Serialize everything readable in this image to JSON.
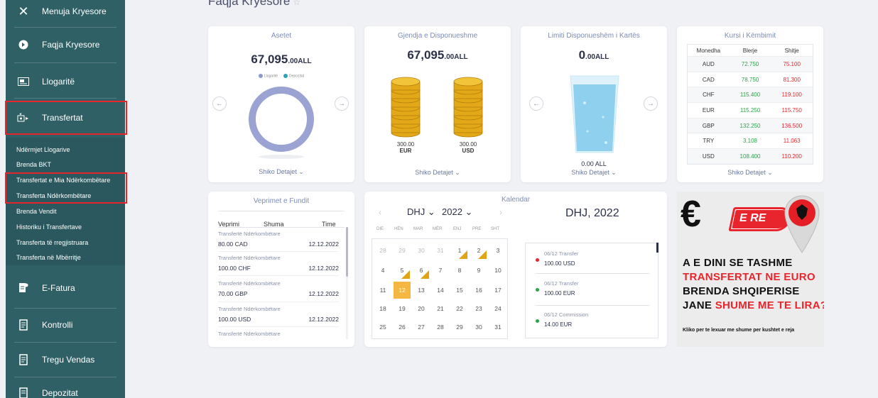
{
  "sidebar": {
    "menu_label": "Menuja Kryesore",
    "items": [
      {
        "label": "Faqja Kryesore",
        "icon": "home-icon"
      },
      {
        "label": "Llogaritë",
        "icon": "account-icon"
      },
      {
        "label": "Transfertat",
        "icon": "transfer-icon"
      },
      {
        "label": "E-Fatura",
        "icon": "invoice-icon"
      },
      {
        "label": "Kontrolli",
        "icon": "control-icon"
      },
      {
        "label": "Tregu Vendas",
        "icon": "market-icon"
      },
      {
        "label": "Depozitat",
        "icon": "deposit-icon"
      }
    ],
    "sub_items": [
      "Ndërmjet Llogarive",
      "Brenda BKT",
      "Transfertat e Mia Ndërkombëtare",
      "Transferta Ndërkombëtare",
      "Brenda Vendit",
      "Historiku i Transfertave",
      "Transferta të rregjistruara",
      "Transferta në Mbërritje"
    ]
  },
  "page": {
    "title": "Faqja Kryesore"
  },
  "assets": {
    "title": "Asetet",
    "amount_int": "67,095",
    "amount_dec": ".00",
    "currency": "ALL",
    "legend": [
      "Llogaritë",
      "Depozitat"
    ],
    "details": "Shiko Detajet"
  },
  "available": {
    "title": "Gjendja e Disponueshme",
    "amount_int": "67,095",
    "amount_dec": ".00",
    "currency": "ALL",
    "coins": [
      {
        "amount": "300.00",
        "currency": "EUR"
      },
      {
        "amount": "300.00",
        "currency": "USD"
      }
    ],
    "details": "Shiko Detajet"
  },
  "card_limit": {
    "title": "Limiti Disponueshëm i Kartës",
    "amount_int": "0",
    "amount_dec": ".00",
    "currency": "ALL",
    "bottom_value": "0.00 ALL",
    "details": "Shiko Detajet"
  },
  "exchange": {
    "title": "Kursi i Këmbimit",
    "headers": [
      "Monedha",
      "Blerje",
      "Shitje"
    ],
    "rows": [
      [
        "AUD",
        "72.750",
        "75.100"
      ],
      [
        "CAD",
        "78.750",
        "81.300"
      ],
      [
        "CHF",
        "115.400",
        "119.100"
      ],
      [
        "EUR",
        "115.250",
        "115.750"
      ],
      [
        "GBP",
        "132.250",
        "136.500"
      ],
      [
        "TRY",
        "3.108",
        "11.063"
      ],
      [
        "USD",
        "108.400",
        "110.200"
      ]
    ],
    "details": "Shiko Detajet"
  },
  "transactions": {
    "title": "Veprimet e Fundit",
    "headers": [
      "Veprimi",
      "Shuma",
      "Time"
    ],
    "items": [
      {
        "desc": "Transfertë Ndërkombëtare",
        "amount": "80.00 CAD",
        "date": "12.12.2022"
      },
      {
        "desc": "Transfertë Ndërkombëtare",
        "amount": "100.00 CHF",
        "date": "12.12.2022"
      },
      {
        "desc": "Transfertë Ndërkombëtare",
        "amount": "70.00 GBP",
        "date": "12.12.2022"
      },
      {
        "desc": "Transfertë Ndërkombëtare",
        "amount": "100.00 USD",
        "date": "12.12.2022"
      },
      {
        "desc": "Transfertë Ndërkombëtare",
        "amount": "",
        "date": ""
      }
    ]
  },
  "calendar": {
    "title": "Kalendar",
    "month": "DHJ",
    "year": "2022",
    "heading": "DHJ, 2022",
    "dow": [
      "DIE",
      "HËN",
      "MAR",
      "MËR",
      "ENJ",
      "PRE",
      "SHT"
    ],
    "weeks": [
      [
        "28",
        "29",
        "30",
        "31",
        "1",
        "2",
        "3"
      ],
      [
        "4",
        "5",
        "6",
        "7",
        "8",
        "9",
        "10"
      ],
      [
        "11",
        "12",
        "13",
        "14",
        "15",
        "16",
        "17"
      ],
      [
        "18",
        "19",
        "20",
        "21",
        "22",
        "23",
        "24"
      ],
      [
        "25",
        "26",
        "27",
        "28",
        "29",
        "30",
        "31"
      ]
    ],
    "events": [
      {
        "title": "06/12 Transfer",
        "value": "100.00 USD",
        "color": "#e8242c"
      },
      {
        "title": "06/12 Transfer",
        "value": "100.00 EUR",
        "color": "#2da24b"
      },
      {
        "title": "06/12 Commission",
        "value": "14.00 EUR",
        "color": "#2da24b"
      }
    ]
  },
  "ad": {
    "badge": "E RE",
    "line1": "A E DINI SE TASHME",
    "line2": "TRANSFERTAT NE EURO",
    "line3": "BRENDA SHQIPERISE",
    "line4a": "JANE ",
    "line4b": "SHUME ME TE LIRA?",
    "footer": "Kliko per te lexuar me shume per kushtet e reja"
  }
}
